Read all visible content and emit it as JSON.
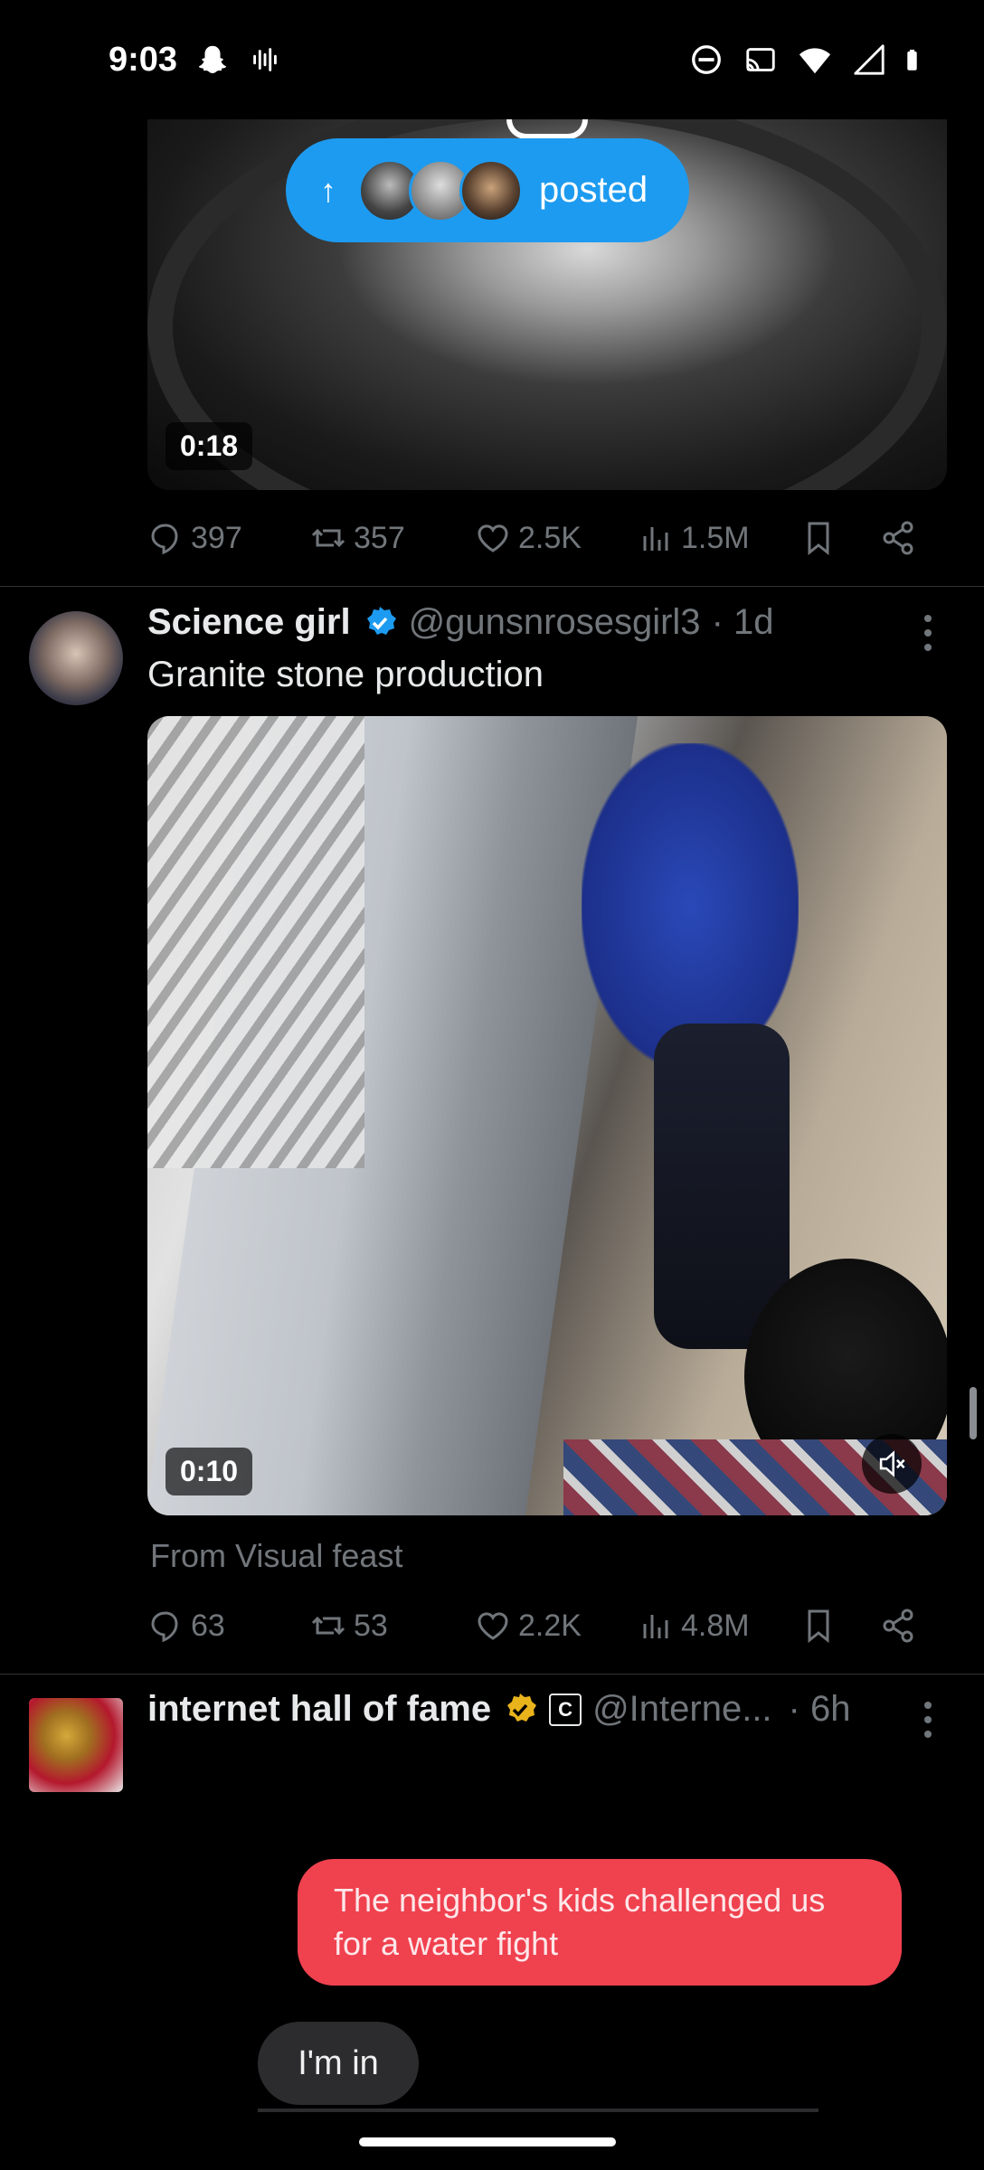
{
  "status_bar": {
    "time": "9:03"
  },
  "tweet1": {
    "video_duration": "0:18",
    "posted_pill": {
      "arrow": "↑",
      "label": "posted"
    },
    "stats": {
      "replies": "397",
      "reposts": "357",
      "likes": "2.5K",
      "views": "1.5M"
    }
  },
  "tweet2": {
    "author_name": "Science girl",
    "handle": "@gunsnrosesgirl3",
    "time": "· 1d",
    "text": "Granite stone production",
    "video_duration": "0:10",
    "from": "From Visual feast",
    "stats": {
      "replies": "63",
      "reposts": "53",
      "likes": "2.2K",
      "views": "4.8M"
    }
  },
  "tweet3": {
    "author_name": "internet hall of fame",
    "badge_letter": "C",
    "handle": "@Interne...",
    "time": "· 6h",
    "messages": {
      "red": "The neighbor's kids challenged us for a water fight",
      "grey": "I'm in"
    }
  },
  "colors": {
    "accent": "#1d9bf0",
    "muted": "#71767b",
    "gold": "#e9b31c",
    "bubble_red": "#f0414f"
  }
}
